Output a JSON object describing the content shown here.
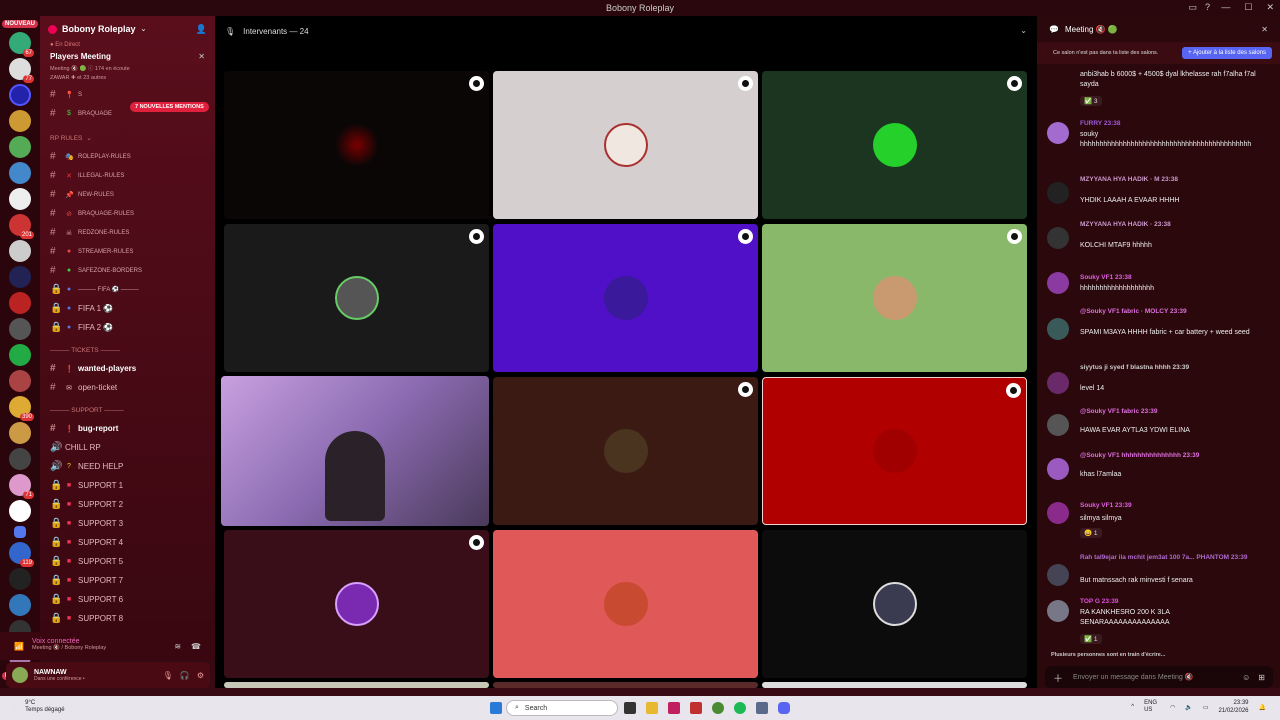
{
  "window": {
    "title": "Bobony Roleplay",
    "controls": [
      "—",
      "☐",
      "✕"
    ]
  },
  "rail": {
    "new_label": "NOUVEAU",
    "counts": [
      "67",
      "77",
      "",
      "",
      "",
      "",
      "",
      "201",
      "",
      "",
      "",
      "",
      "",
      "",
      "390",
      "",
      "",
      "71",
      "",
      "",
      "119",
      "",
      "",
      "",
      "7"
    ]
  },
  "server": {
    "name": "Bobony Roleplay"
  },
  "event": {
    "live": "● En Direct",
    "title": "Players Meeting",
    "close": "✕",
    "sub1": "Meeting 🔇 🟢 ⓘ 174 en écoute",
    "sub2": "ZAWAR ✚ et 23 autres"
  },
  "mention_pill": "7 NOUVELLES MENTIONS",
  "channels_top": [
    {
      "prefix": "S",
      "label": ""
    },
    {
      "prefix": "",
      "label": "BRAQUAGE"
    }
  ],
  "rp_rules": {
    "header": "RP RULES",
    "items": [
      "ROLEPLAY-RULES",
      "ILLEGAL-RULES",
      "NEW-RULES",
      "BRAQUAGE-RULES",
      "REDZONE-RULES",
      "STREAMER-RULES",
      "SAFEZONE-BORDERS"
    ]
  },
  "fifa": {
    "header": "——— FIFA ⚽ ———",
    "items": [
      "FIFA 1 ⚽",
      "FIFA 2 ⚽"
    ]
  },
  "tickets": {
    "header": "——— TICKETS ———",
    "items": [
      "wanted-players",
      "open-ticket"
    ]
  },
  "support": {
    "header": "——— SUPPORT ———",
    "items": [
      "bug-report",
      "CHILL RP",
      "NEED HELP",
      "SUPPORT 1",
      "SUPPORT 2",
      "SUPPORT 3",
      "SUPPORT 4",
      "SUPPORT 5",
      "SUPPORT 7",
      "SUPPORT 6",
      "SUPPORT 8"
    ]
  },
  "voice": {
    "status": "Voix connectée",
    "channel": "Meeting 🔇 / Bobony Roleplay"
  },
  "user": {
    "name": "NAWNAW",
    "status": "Dans une conférence •"
  },
  "stage": {
    "label": "Intervenants — 24"
  },
  "chat": {
    "title": "Meeting 🔇 🟢",
    "notice": "Ce salon n'est pas dans ta liste des salons.",
    "notice_button": "+ Ajouter à la liste des salons",
    "messages": [
      {
        "name": "",
        "text": "anbi3hab b 6000$ + 4500$ dyal lkhelasse rah f7alha f7al sayda",
        "react": "✅ 3"
      },
      {
        "name": "FURRY 23:38",
        "text": "souky hhhhhhhhhhhhhhhhhhhhhhhhhhhhhhhhhhhhhhhhhhhh",
        "react": ""
      },
      {
        "name": "MZYYANA HYA HADIK · M 23:38",
        "text": "YHDIK LAAAH A EVAAR HHHH",
        "react": ""
      },
      {
        "name": "MZYYANA HYA HADIK · 23:38",
        "text": "KOLCHI MTAF9 hhhhh",
        "react": ""
      },
      {
        "name": "Souky VF1 23:38",
        "text": "hhhhhhhhhhhhhhhhhhh",
        "react": ""
      },
      {
        "name": "@Souky VF1 fabric · MOLCY 23:39",
        "text": "SPAMI M3AYA HHHH fabric + car battery + weed seed",
        "react": ""
      },
      {
        "name": "siyytus ji syed f blastna hhhh 23:39",
        "text": "level 14",
        "react": ""
      },
      {
        "name": "@Souky VF1 fabric 23:39",
        "text": "HAWA EVAR AYTLA3 YDWI ELINA",
        "react": ""
      },
      {
        "name": "@Souky VF1 hhhhhhhhhhhhhhh 23:39",
        "text": "khas l7amlaa",
        "react": ""
      },
      {
        "name": "Souky VF1 23:39",
        "text": "silmya silmya",
        "react": "😄 1"
      },
      {
        "name": "Rah tal9ejar ila mchit jem3at 100 7a... PHANTOM 23:39",
        "text": "But matnssach rak minvesti f senara",
        "react": ""
      },
      {
        "name": "TOP G 23:39",
        "text": "RA KANKHESRO 200 K 3LA SENARAAAAAAAAAAAAAA",
        "react": "✅ 1"
      }
    ],
    "typing": "Plusieurs personnes sont en train d'écrire...",
    "input_placeholder": "Envoyer un message dans Meeting 🔇"
  },
  "taskbar": {
    "temp": "9°C",
    "weather": "Temps dégagé",
    "search": "Search",
    "lang": "ENG US",
    "time": "23:39",
    "date": "21/02/2026"
  }
}
